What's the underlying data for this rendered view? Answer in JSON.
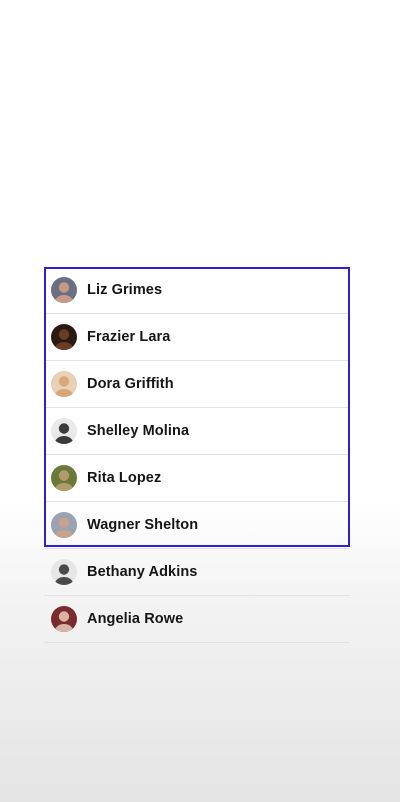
{
  "contacts": [
    {
      "name": "Liz Grimes",
      "avatar": "person-avatar-icon",
      "tone": "#6a6f86",
      "skin": "#c79a83"
    },
    {
      "name": "Frazier Lara",
      "avatar": "person-avatar-icon",
      "tone": "#2a1a12",
      "skin": "#6b3d24"
    },
    {
      "name": "Dora Griffith",
      "avatar": "person-avatar-icon",
      "tone": "#e7d2b6",
      "skin": "#d8a679"
    },
    {
      "name": "Shelley Molina",
      "avatar": "person-avatar-icon",
      "tone": "#e9e9e9",
      "skin": "#3a3a3a"
    },
    {
      "name": "Rita Lopez",
      "avatar": "person-avatar-icon",
      "tone": "#6b7a3a",
      "skin": "#b59a6a"
    },
    {
      "name": "Wagner Shelton",
      "avatar": "person-avatar-icon",
      "tone": "#9aa3b0",
      "skin": "#c7a18a"
    },
    {
      "name": "Bethany Adkins",
      "avatar": "person-avatar-icon",
      "tone": "#e6e6e6",
      "skin": "#4a4a4a"
    },
    {
      "name": "Angelia Rowe",
      "avatar": "person-avatar-icon",
      "tone": "#7a2b2f",
      "skin": "#d7b3a4"
    }
  ],
  "selection_color": "#2f1fd6"
}
